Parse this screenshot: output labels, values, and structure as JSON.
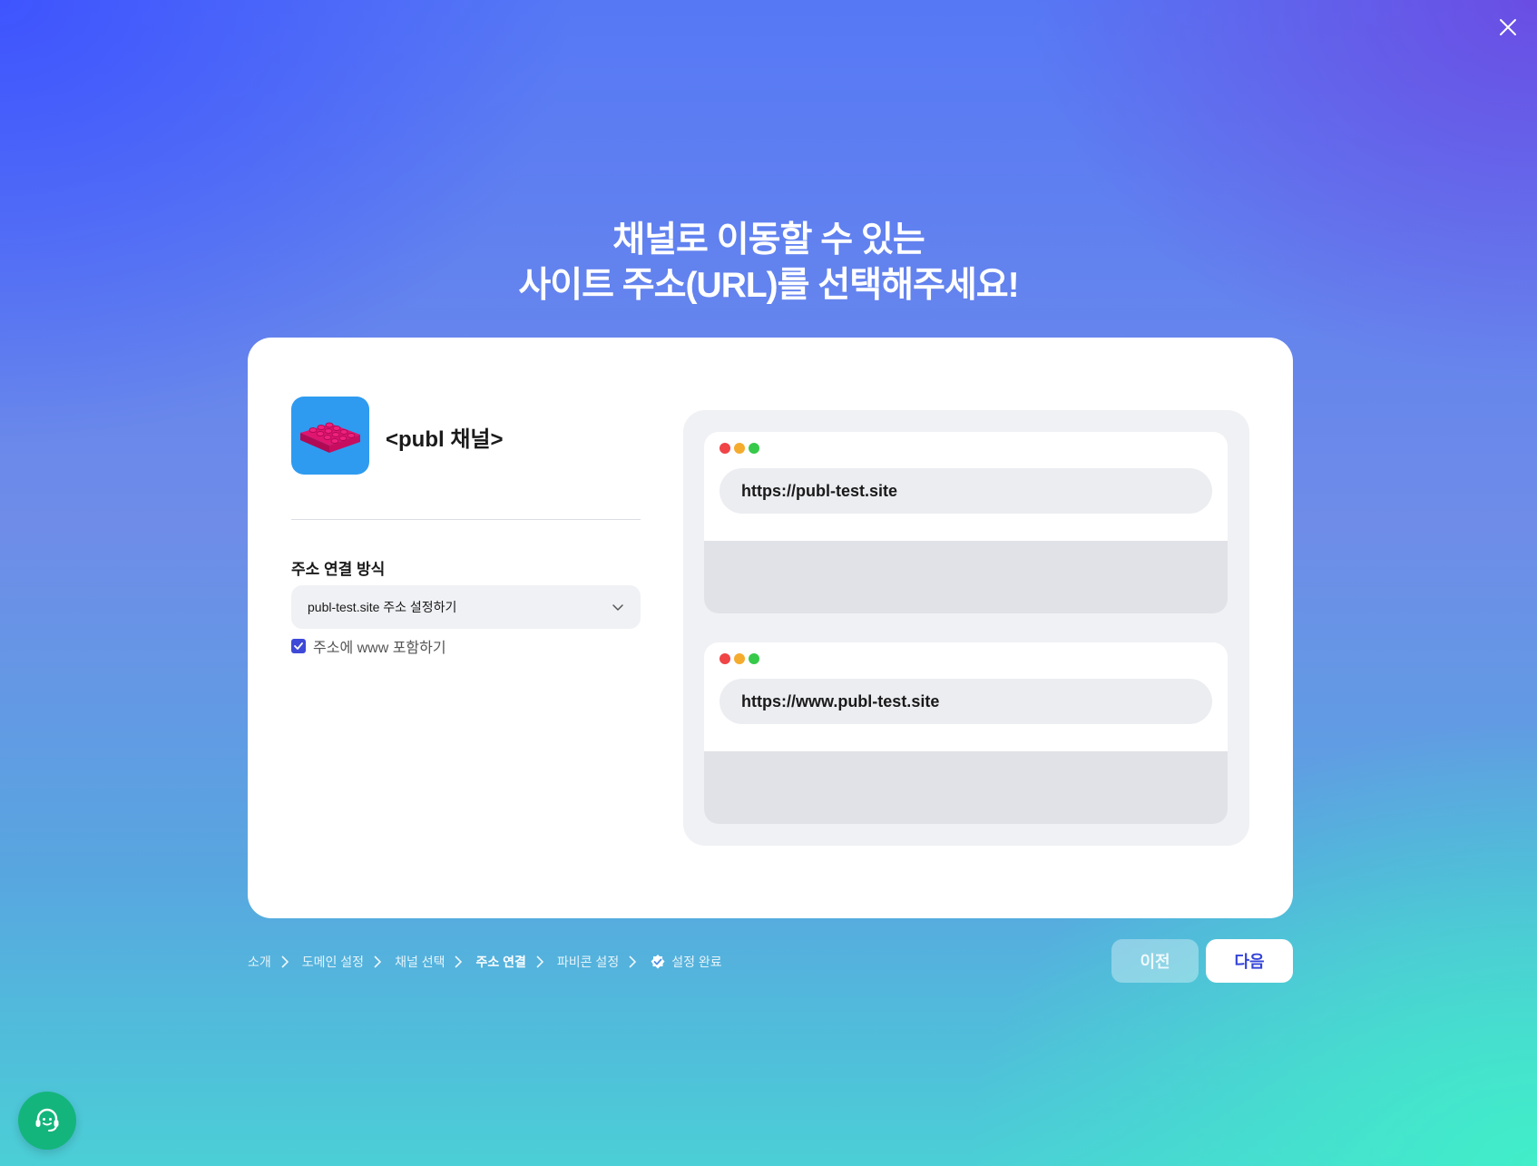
{
  "header": {
    "title_line1": "채널로 이동할 수 있는",
    "title_line2": "사이트 주소(URL)를 선택해주세요!"
  },
  "channel": {
    "name": "<publ 채널>"
  },
  "form": {
    "field_label": "주소 연결 방식",
    "select_value": "publ-test.site 주소 설정하기",
    "checkbox_label": "주소에 www 포함하기",
    "checkbox_checked": true
  },
  "preview": {
    "url_1": "https://publ-test.site",
    "url_2": "https://www.publ-test.site"
  },
  "steps": [
    {
      "label": "소개"
    },
    {
      "label": "도메인 설정"
    },
    {
      "label": "채널 선택"
    },
    {
      "label": "주소 연결",
      "active": true
    },
    {
      "label": "파비콘 설정"
    },
    {
      "label": "설정 완료"
    }
  ],
  "buttons": {
    "prev": "이전",
    "next": "다음"
  },
  "colors": {
    "accent": "#3444d9",
    "support_button": "#13b57c",
    "logo_bg": "#2e9bf0",
    "dot_red": "#f04446",
    "dot_yellow": "#f5ab2e",
    "dot_green": "#37c94a"
  },
  "icons": {
    "close": "close-icon",
    "dropdown": "chevron-down-icon",
    "checkbox": "check-icon",
    "step_separator": "chevron-right-icon",
    "complete": "verified-check-icon",
    "support": "headset-icon",
    "logo": "lego-brick-icon"
  }
}
